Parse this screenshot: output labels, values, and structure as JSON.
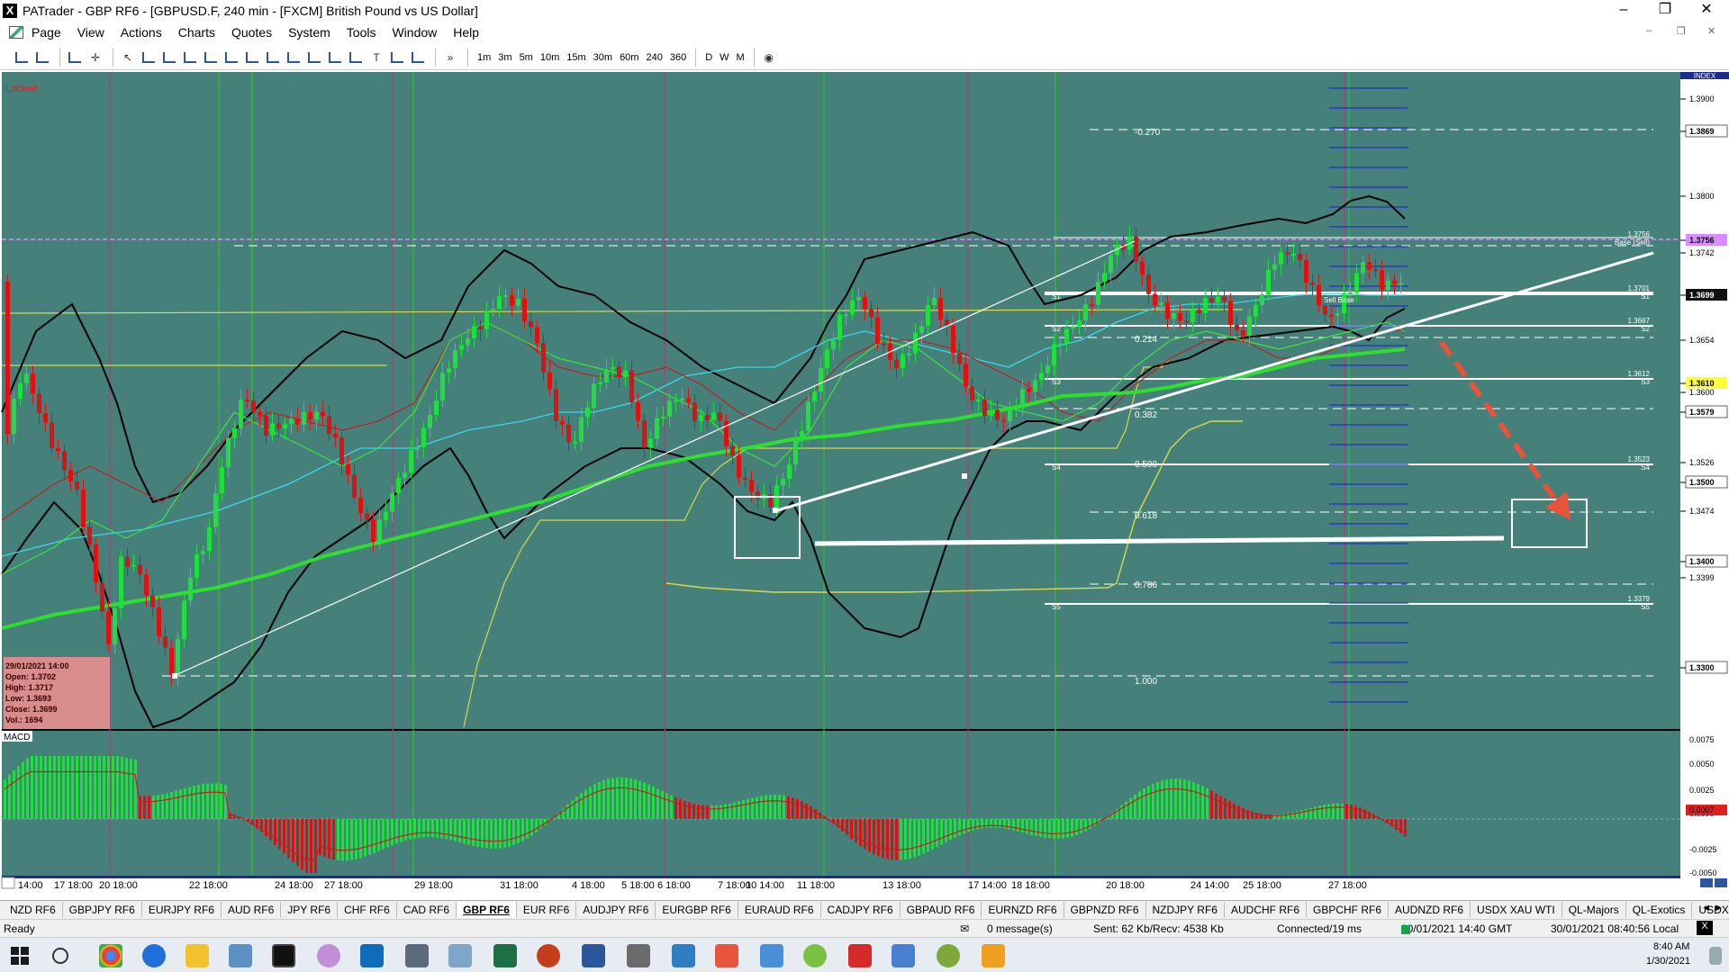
{
  "window": {
    "title": "PATrader - GBP RF6 - [GBPUSD.F, 240 min - [FXCM] British Pound vs US Dollar]",
    "controls": [
      "–",
      "❐",
      "✕"
    ]
  },
  "menu": {
    "items": [
      "Page",
      "View",
      "Actions",
      "Charts",
      "Quotes",
      "System",
      "Tools",
      "Window",
      "Help"
    ]
  },
  "toolbar": {
    "timeframes": [
      "1m",
      "3m",
      "5m",
      "10m",
      "15m",
      "30m",
      "60m",
      "240",
      "360"
    ],
    "periods": [
      "D",
      "W",
      "M"
    ],
    "more": "»"
  },
  "chart": {
    "locked_label": "Locked",
    "index_label": "INDEX",
    "macd_label": "MACD",
    "colors": {
      "background": "#45807a",
      "bullish": "#1ee03a",
      "bearish": "#e01010",
      "ema_green": "#2ee02e",
      "bollinger": "#000000",
      "trend_white": "#ffffff",
      "yellow_line": "#d8d84a"
    },
    "price_axis": [
      "1.3900",
      "1.3869",
      "1.3800",
      "1.3756",
      "1.3742",
      "1.3699",
      "1.3654",
      "1.3610",
      "1.3600",
      "1.3579",
      "1.3526",
      "1.3500",
      "1.3474",
      "1.3400",
      "1.3399",
      "1.3300"
    ],
    "macd_axis": [
      "0.0075",
      "0.0050",
      "0.0025",
      "0.0000",
      "0.0007",
      "-0.0025",
      "-0.0050"
    ],
    "time_axis": [
      "14:00",
      "17 18:00",
      "20 18:00",
      "22 18:00",
      "24 18:00",
      "27 18:00",
      "29 18:00",
      "31 18:00",
      "4 18:00",
      "5 18:00",
      "6 18:00",
      "7 18:00",
      "10 14:00",
      "11 18:00",
      "13 18:00",
      "17 14:00",
      "18 18:00",
      "20 18:00",
      "24 14:00",
      "25 18:00",
      "27 18:00"
    ],
    "fib_levels": [
      "-0.270",
      "0.214",
      "0.382",
      "0.500",
      "0.618",
      "0.786",
      "1.000"
    ],
    "pivot_labels": [
      "1.3756",
      "Base (Sell)",
      "1.3701",
      "S1",
      "1.3667",
      "S2",
      "1.3612",
      "S3",
      "1.3523",
      "S4",
      "1.3379",
      "S5"
    ],
    "pivot_short": [
      "S1",
      "S2",
      "S3",
      "S4",
      "S5"
    ],
    "sell_base": "Sell Base",
    "ohlc_box": {
      "date": "29/01/2021 14:00",
      "open": "Open: 1.3702",
      "high": "High: 1.3717",
      "low": "Low: 1.3693",
      "close": "Close: 1.3699",
      "vol": "Vol.: 1694"
    }
  },
  "tabs": {
    "items": [
      "NZD RF6",
      "GBPJPY RF6",
      "EURJPY RF6",
      "AUD RF6",
      "JPY RF6",
      "CHF RF6",
      "CAD RF6",
      "GBP RF6",
      "EUR RF6",
      "AUDJPY RF6",
      "EURGBP RF6",
      "EURAUD RF6",
      "CADJPY RF6",
      "GBPAUD RF6",
      "EURNZD RF6",
      "GBPNZD RF6",
      "NZDJPY RF6",
      "AUDCHF RF6",
      "GBPCHF RF6",
      "AUDNZD RF6",
      "USDX XAU WTI",
      "QL-Majors",
      "QL-Exotics",
      "USDX RF6"
    ],
    "active": "GBP RF6",
    "arrows": "◄ ►"
  },
  "status": {
    "ready": "Ready",
    "messages": "0 message(s)",
    "traffic": "Sent: 62 Kb/Recv: 4538 Kb",
    "connection": "Connected/19 ms",
    "gmt": "30/01/2021 14:40 GMT",
    "local": "30/01/2021 08:40:56 Local"
  },
  "taskbar": {
    "time": "8:40 AM",
    "date": "1/30/2021"
  }
}
